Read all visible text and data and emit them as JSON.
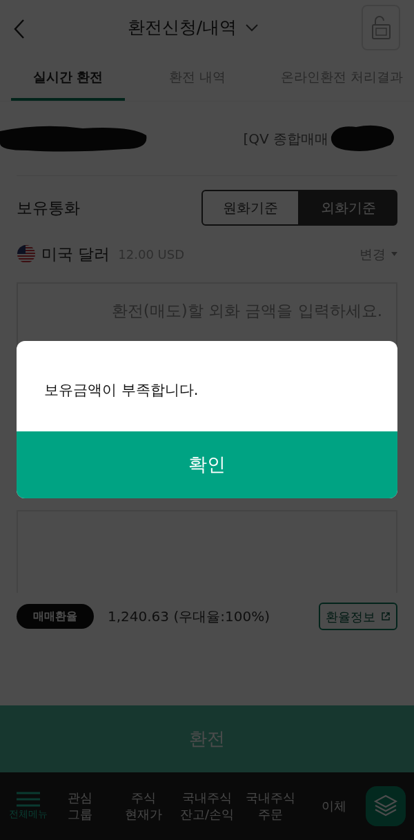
{
  "header": {
    "title": "환전신청/내역"
  },
  "tabs": [
    {
      "label": "실시간 환전",
      "selected": true
    },
    {
      "label": "환전 내역",
      "selected": false
    },
    {
      "label": "온라인환전 처리결과",
      "selected": false
    }
  ],
  "account": {
    "label": "[QV 종합매매"
  },
  "holding": {
    "label": "보유통화",
    "toggle": [
      {
        "label": "원화기준",
        "selected": false
      },
      {
        "label": "외화기준",
        "selected": true
      }
    ]
  },
  "currency": {
    "name": "미국 달러",
    "amount": "12.00 USD",
    "change": "변경"
  },
  "amount_input": {
    "placeholder": "환전(매도)할 외화 금액을 입력하세요."
  },
  "rate": {
    "badge": "매매환율",
    "value": "1,240.63 (우대율:100%)",
    "info": "환율정보"
  },
  "submit": {
    "label": "환전"
  },
  "bottom_nav": {
    "menu": "전체메뉴",
    "items": [
      "관심\n그룹",
      "주식\n현재가",
      "국내주식\n잔고/손익",
      "국내주식\n주문",
      "이체"
    ]
  },
  "dialog": {
    "message": "보유금액이 부족합니다.",
    "confirm": "확인"
  }
}
